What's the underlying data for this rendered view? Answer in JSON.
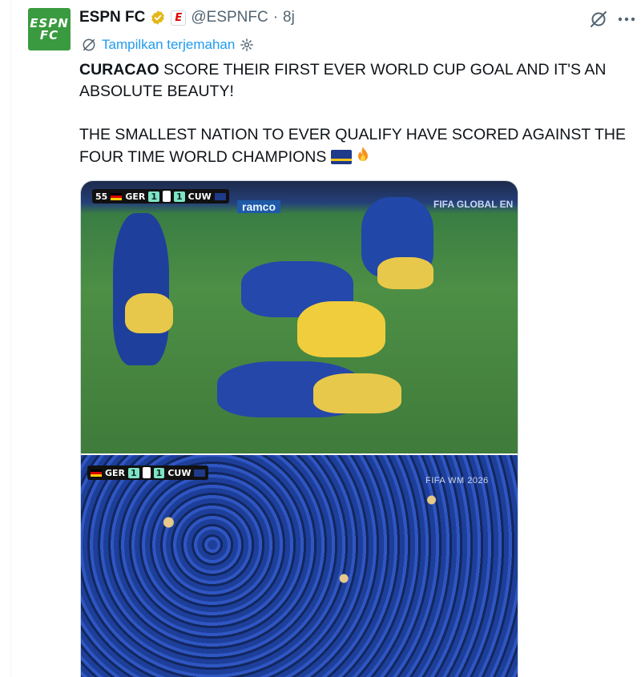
{
  "account": {
    "avatar_text_line1": "ESPN",
    "avatar_text_line2": "FC",
    "display_name": "ESPN FC",
    "affiliate_badge": "E",
    "handle": "@ESPNFC",
    "separator": "·",
    "time": "8j"
  },
  "icons": {
    "verified": "verified-badge-icon",
    "affiliate": "espn-affiliate-badge-icon",
    "grok": "grok-icon",
    "more": "more-icon",
    "translate": "translate-globe-icon",
    "settings": "gear-icon"
  },
  "translate": {
    "label": "Tampilkan terjemahan"
  },
  "tweet": {
    "line1_bold": "CURACAO",
    "line1_rest": " SCORE THEIR FIRST EVER WORLD CUP GOAL AND IT'S AN ABSOLUTE BEAUTY!",
    "line2": "THE SMALLEST NATION TO EVER QUALIFY HAVE SCORED AGAINST THE FOUR TIME WORLD CHAMPIONS"
  },
  "media": {
    "scorebug1": {
      "prefix": "55",
      "home": "GER",
      "home_score": "1",
      "away_score": "1",
      "away": "CUW"
    },
    "scorebug2": {
      "home": "GER",
      "home_score": "1",
      "away_score": "1",
      "away": "CUW"
    },
    "board_left": "ramco",
    "board_right": "FIFA GLOBAL EN",
    "watermark": "FIFA WM 2026"
  },
  "colors": {
    "link": "#1d9bf0",
    "secondary_text": "#536471",
    "avatar_bg": "#3a9a3f",
    "verified_gold": "#e2b719"
  }
}
